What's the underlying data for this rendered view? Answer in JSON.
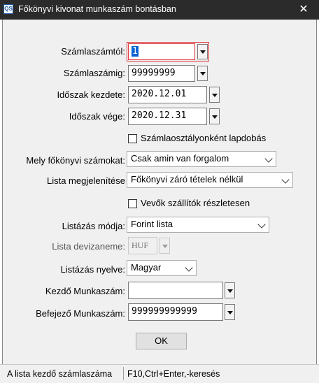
{
  "window": {
    "title": "Főkönyvi kivonat munkaszám bontásban",
    "app_icon_text": "QS",
    "close_glyph": "✕"
  },
  "form": {
    "szamlaszamtol": {
      "label": "Számlaszámtól:",
      "value": "1"
    },
    "szamlaszamig": {
      "label": "Számlaszámig:",
      "value": "99999999"
    },
    "idoszak_kezdete": {
      "label": "Időszak kezdete:",
      "value": "2020.12.01"
    },
    "idoszak_vege": {
      "label": "Időszak vége:",
      "value": "2020.12.31"
    },
    "lapdobas": {
      "label": "Számlaosztályonként lapdobás",
      "checked": false
    },
    "mely_szamokat": {
      "label": "Mely főkönyvi számokat:",
      "value": "Csak amin van forgalom"
    },
    "lista_megjelenitese": {
      "label": "Lista megjelenítése",
      "value": "Főkönyvi záró tételek nélkül"
    },
    "vevok_szallitok": {
      "label": "Vevők szállítók részletesen",
      "checked": false
    },
    "listazas_modja": {
      "label": "Listázás módja:",
      "value": "Forint lista"
    },
    "lista_devizaneme": {
      "label": "Lista devizaneme:",
      "value": "HUF"
    },
    "listazas_nyelve": {
      "label": "Listázás nyelve:",
      "value": "Magyar"
    },
    "kezdo_munkaszam": {
      "label": "Kezdő Munkaszám:",
      "value": ""
    },
    "befejezo_munkaszam": {
      "label": "Befejező Munkaszám:",
      "value": "999999999999"
    },
    "ok_label": "OK"
  },
  "statusbar": {
    "hint": "A lista kezdő számlaszáma",
    "shortcuts": "F10,Ctrl+Enter,-keresés"
  }
}
